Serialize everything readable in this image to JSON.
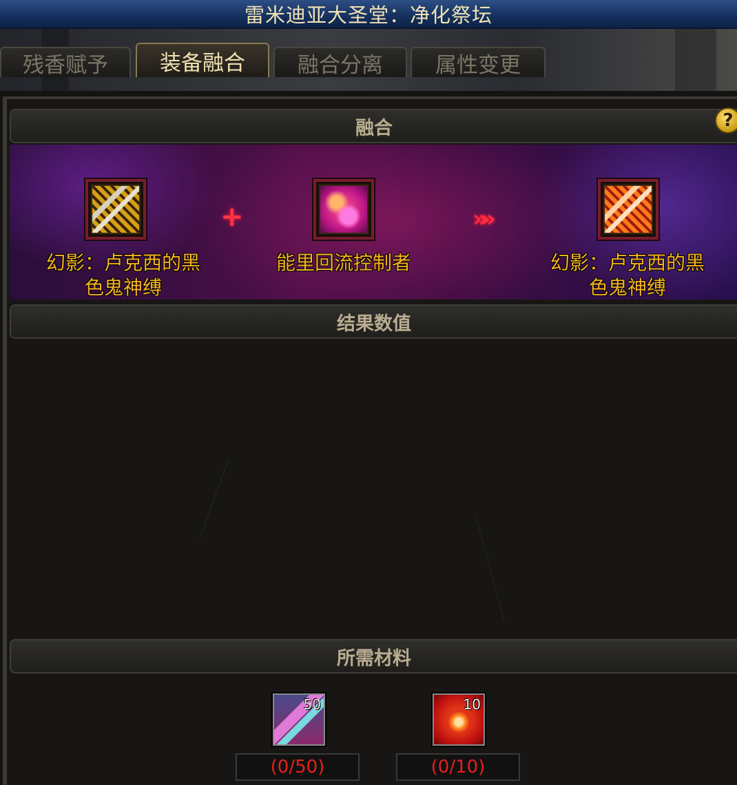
{
  "window": {
    "title": "雷米迪亚大圣堂：净化祭坛"
  },
  "tabs": [
    {
      "label": "残香赋予",
      "active": false
    },
    {
      "label": "装备融合",
      "active": true
    },
    {
      "label": "融合分离",
      "active": false
    },
    {
      "label": "属性变更",
      "active": false
    }
  ],
  "help": {
    "symbol": "?"
  },
  "fusion": {
    "header": "融合",
    "base_item": {
      "name": "幻影：卢克西的黑色鬼神缚",
      "line1": "幻影：卢克西的黑",
      "line2": "色鬼神缚",
      "icon": "bracer-icon"
    },
    "plus_symbol": "+",
    "material_item": {
      "name": "能里回流控制者",
      "icon": "energy-orb-icon"
    },
    "arrows_symbol": "»»",
    "result_item": {
      "name": "幻影：卢克西的黑色鬼神缚",
      "line1": "幻影：卢克西的黑",
      "line2": "色鬼神缚",
      "icon": "fused-bracer-icon"
    }
  },
  "result_values": {
    "header": "结果数值"
  },
  "materials": {
    "header": "所需材料",
    "items": [
      {
        "icon": "crystal-icon",
        "stack": "50",
        "count_text": "(0/50)"
      },
      {
        "icon": "sun-crystal-icon",
        "stack": "10",
        "count_text": "(0/10)"
      }
    ]
  },
  "colors": {
    "item_name": "#f7b321",
    "insufficient_count": "#e8201a",
    "title_bar": "#1b3a6e"
  }
}
